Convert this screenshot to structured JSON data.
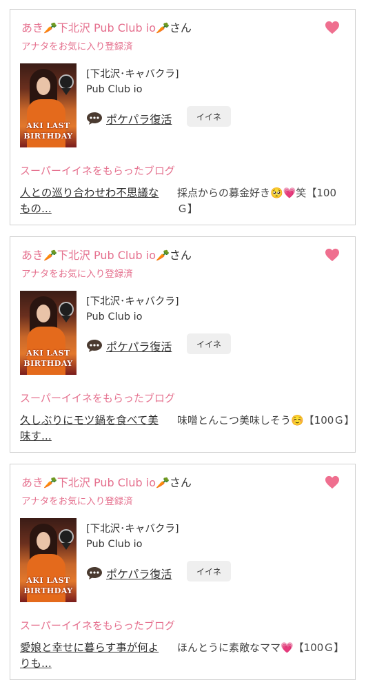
{
  "cards": [
    {
      "name_prefix": "あき🥕下北沢 Pub Club io🥕",
      "name_suffix": "さん",
      "fav_status": "アナタをお気に入り登録済",
      "shop_area": "[下北沢･キャバクラ]",
      "shop_name": "Pub Club io",
      "store_link": "ポケパラ復活",
      "iine_label": "イイネ",
      "photo_caption_1": "AKI LAST",
      "photo_caption_2": "BIRTHDAY",
      "section_label": "スーパーイイネをもらったブログ",
      "blog_title": "人との巡り合わせわ不思議なもの...",
      "comment_text": "採点からの募金好き🥺💗笑【100Ｇ】"
    },
    {
      "name_prefix": "あき🥕下北沢 Pub Club io🥕",
      "name_suffix": "さん",
      "fav_status": "アナタをお気に入り登録済",
      "shop_area": "[下北沢･キャバクラ]",
      "shop_name": "Pub Club io",
      "store_link": "ポケパラ復活",
      "iine_label": "イイネ",
      "photo_caption_1": "AKI LAST",
      "photo_caption_2": "BIRTHDAY",
      "section_label": "スーパーイイネをもらったブログ",
      "blog_title": "久しぶりにモツ鍋を食べて美味す...",
      "comment_text": "味噌とんこつ美味しそう☺️【100Ｇ】"
    },
    {
      "name_prefix": "あき🥕下北沢 Pub Club io🥕",
      "name_suffix": "さん",
      "fav_status": "アナタをお気に入り登録済",
      "shop_area": "[下北沢･キャバクラ]",
      "shop_name": "Pub Club io",
      "store_link": "ポケパラ復活",
      "iine_label": "イイネ",
      "photo_caption_1": "AKI LAST",
      "photo_caption_2": "BIRTHDAY",
      "section_label": "スーパーイイネをもらったブログ",
      "blog_title": "愛娘と幸せに暮らす事が何よりも...",
      "comment_text": "ほんとうに素敵なママ💗【100Ｇ】"
    }
  ],
  "colors": {
    "accent_pink": "#e5708e",
    "text": "#333333",
    "border": "#cfcfcf",
    "button_bg": "#efefef"
  },
  "icons": {
    "favorite": "heart-icon",
    "chat": "speech-bubble-icon"
  }
}
